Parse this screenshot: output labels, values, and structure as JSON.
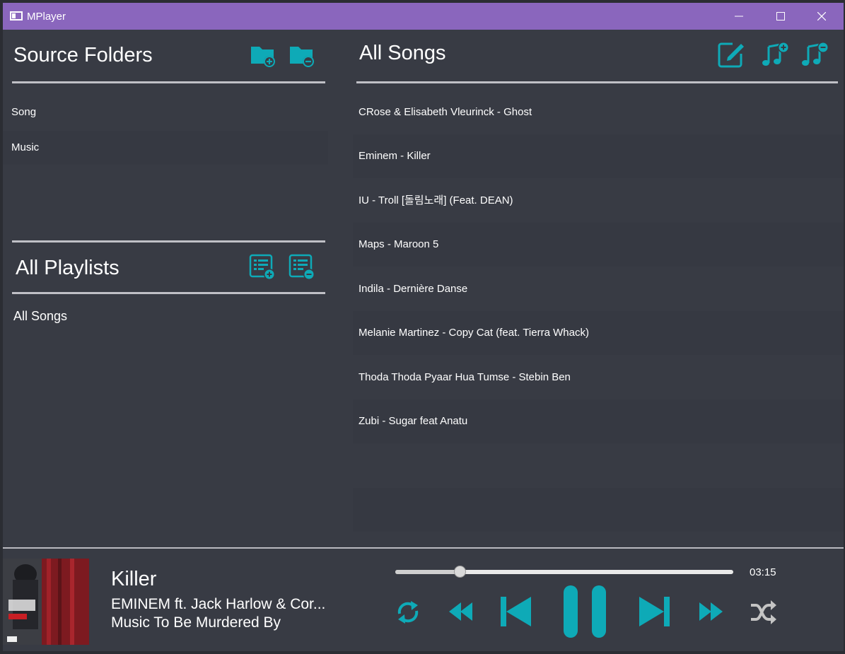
{
  "window": {
    "title": "MPlayer"
  },
  "source_folders": {
    "title": "Source Folders",
    "items": [
      "Song",
      "Music"
    ]
  },
  "playlists": {
    "title": "All Playlists",
    "items": [
      "All Songs"
    ]
  },
  "songs": {
    "title": "All Songs",
    "items": [
      "CRose & Elisabeth Vleurinck - Ghost",
      "Eminem - Killer",
      "IU - Troll [돌림노래] (Feat. DEAN)",
      "Maps - Maroon 5",
      "Indila - Dernière Danse",
      "Melanie Martinez - Copy Cat (feat. Tierra Whack)",
      "Thoda Thoda Pyaar Hua Tumse - Stebin Ben",
      "Zubi - Sugar feat Anatu"
    ]
  },
  "now_playing": {
    "title": "Killer",
    "artist": "EMINEM ft. Jack Harlow & Cor...",
    "album": "Music To Be Murdered By",
    "time": "03:15",
    "progress": 0.19
  },
  "colors": {
    "accent": "#0eaab7",
    "titlebar": "#8a66bd",
    "background": "#383b44"
  },
  "icons": {
    "folder_add": "folder-plus-icon",
    "folder_remove": "folder-minus-icon",
    "playlist_add": "playlist-plus-icon",
    "playlist_remove": "playlist-minus-icon",
    "edit": "edit-icon",
    "song_add": "music-note-plus-icon",
    "song_remove": "music-note-minus-icon",
    "repeat": "repeat-icon",
    "rewind": "rewind-icon",
    "previous": "skip-previous-icon",
    "pause": "pause-icon",
    "next": "skip-next-icon",
    "fast_forward": "fast-forward-icon",
    "shuffle": "shuffle-icon"
  }
}
